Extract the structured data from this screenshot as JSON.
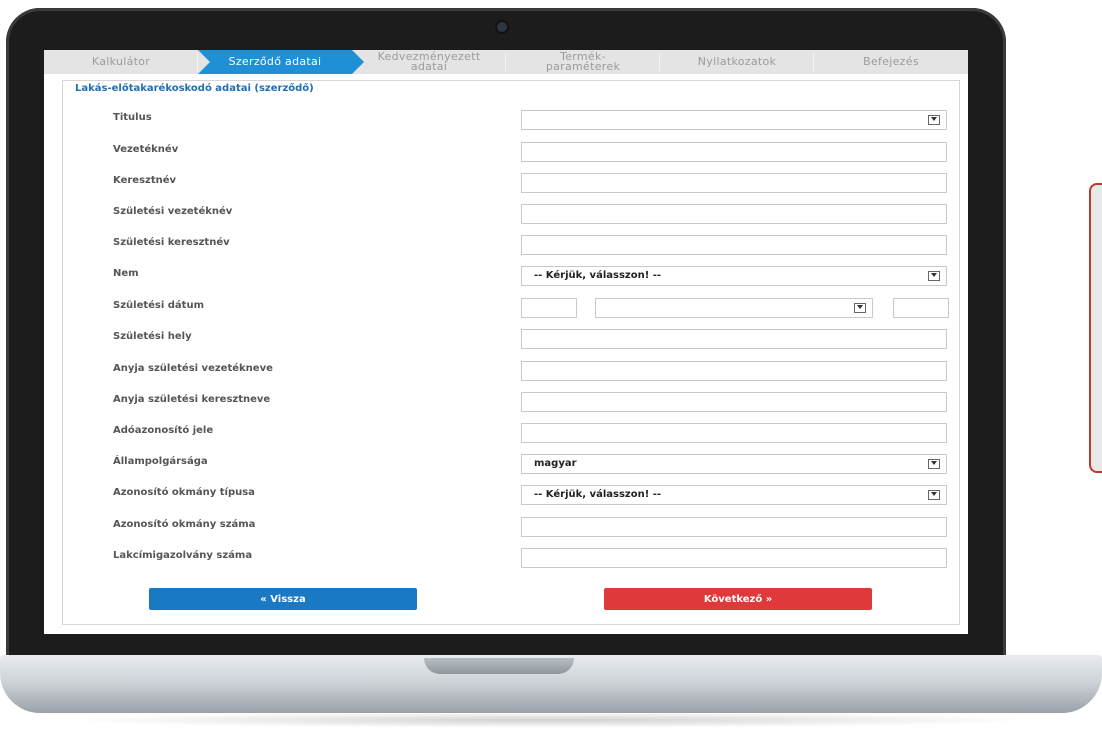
{
  "steps": [
    {
      "label": "Kalkulátor",
      "active": false
    },
    {
      "label": "Szerződő adatai",
      "active": true
    },
    {
      "label": "Kedvezményezett adatai",
      "active": false
    },
    {
      "label": "Termék-paraméterek",
      "active": false
    },
    {
      "label": "Nyilatkozatok",
      "active": false
    },
    {
      "label": "Befejezés",
      "active": false
    }
  ],
  "section_title": "Lakás-előtakarékoskodó adatai (szerződő)",
  "fields": {
    "titulus": {
      "label": "Titulus",
      "value": ""
    },
    "vezeteknev": {
      "label": "Vezetéknév",
      "value": ""
    },
    "keresztnev": {
      "label": "Keresztnév",
      "value": ""
    },
    "szul_vezeteknev": {
      "label": "Születési vezetéknév",
      "value": ""
    },
    "szul_keresztnev": {
      "label": "Születési keresztnév",
      "value": ""
    },
    "nem": {
      "label": "Nem",
      "value": "-- Kérjük, válasszon! --"
    },
    "szul_datum": {
      "label": "Születési dátum",
      "day": "",
      "month": "",
      "year": ""
    },
    "szul_hely": {
      "label": "Születési hely",
      "value": ""
    },
    "anyja_vezetekneve": {
      "label": "Anyja születési vezetékneve",
      "value": ""
    },
    "anyja_keresztneve": {
      "label": "Anyja születési keresztneve",
      "value": ""
    },
    "adoazonosito": {
      "label": "Adóazonosító jele",
      "value": ""
    },
    "allampolgarsag": {
      "label": "Állampolgársága",
      "value": "magyar"
    },
    "okmany_tipusa": {
      "label": "Azonosító okmány típusa",
      "value": "-- Kérjük, válasszon! --"
    },
    "okmany_szama": {
      "label": "Azonosító okmány száma",
      "value": ""
    },
    "lakcim_szama": {
      "label": "Lakcímigazolvány száma",
      "value": ""
    }
  },
  "buttons": {
    "back": "« Vissza",
    "next": "Következő »"
  },
  "colors": {
    "accent_blue": "#1f8fd6",
    "back_button": "#1a79c2",
    "next_button": "#e0393b",
    "section_title": "#1f6fb5"
  }
}
